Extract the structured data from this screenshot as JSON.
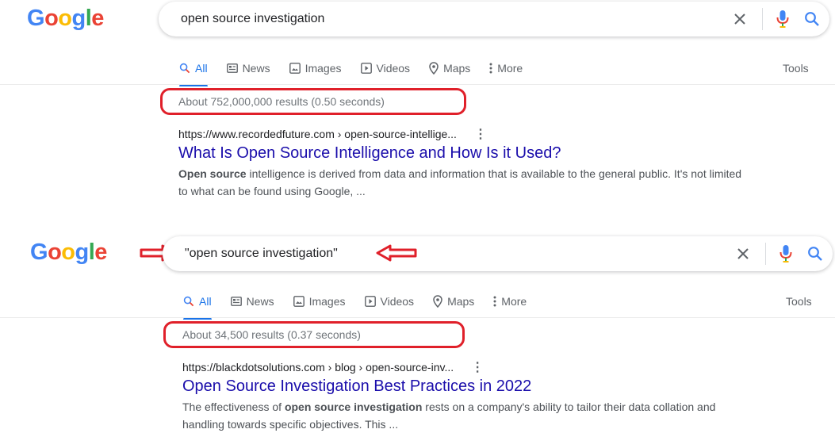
{
  "colors": {
    "google_blue": "#4285F4",
    "google_red": "#EA4335",
    "google_yellow": "#FBBC05",
    "google_green": "#34A853",
    "link_title": "#1a0dab",
    "active_tab": "#1a73e8",
    "annotation_red": "#e0202a"
  },
  "logo_letters": [
    "G",
    "o",
    "o",
    "g",
    "l",
    "e"
  ],
  "tabs": {
    "all": "All",
    "news": "News",
    "images": "Images",
    "videos": "Videos",
    "maps": "Maps",
    "more": "More",
    "tools": "Tools"
  },
  "icons": {
    "clear": "close-icon",
    "mic": "microphone-icon",
    "search": "search-icon"
  },
  "panel1": {
    "query": "open source investigation",
    "stats": "About 752,000,000 results (0.50 seconds)",
    "result": {
      "url": "https://www.recordedfuture.com › open-source-intellige...",
      "title": "What Is Open Source Intelligence and How Is it Used?",
      "snippet_bold": "Open source",
      "snippet_rest": " intelligence is derived from data and information that is available to the general public. It's not limited to what can be found using Google, ..."
    }
  },
  "panel2": {
    "query": "\"open source investigation\"",
    "stats": "About 34,500 results (0.37 seconds)",
    "result": {
      "url": "https://blackdotsolutions.com › blog › open-source-inv...",
      "title": "Open Source Investigation Best Practices in 2022",
      "snippet_pre": "The effectiveness of ",
      "snippet_bold": "open source investigation",
      "snippet_rest": " rests on a company's ability to tailor their data collation and handling towards specific objectives. This ..."
    }
  }
}
